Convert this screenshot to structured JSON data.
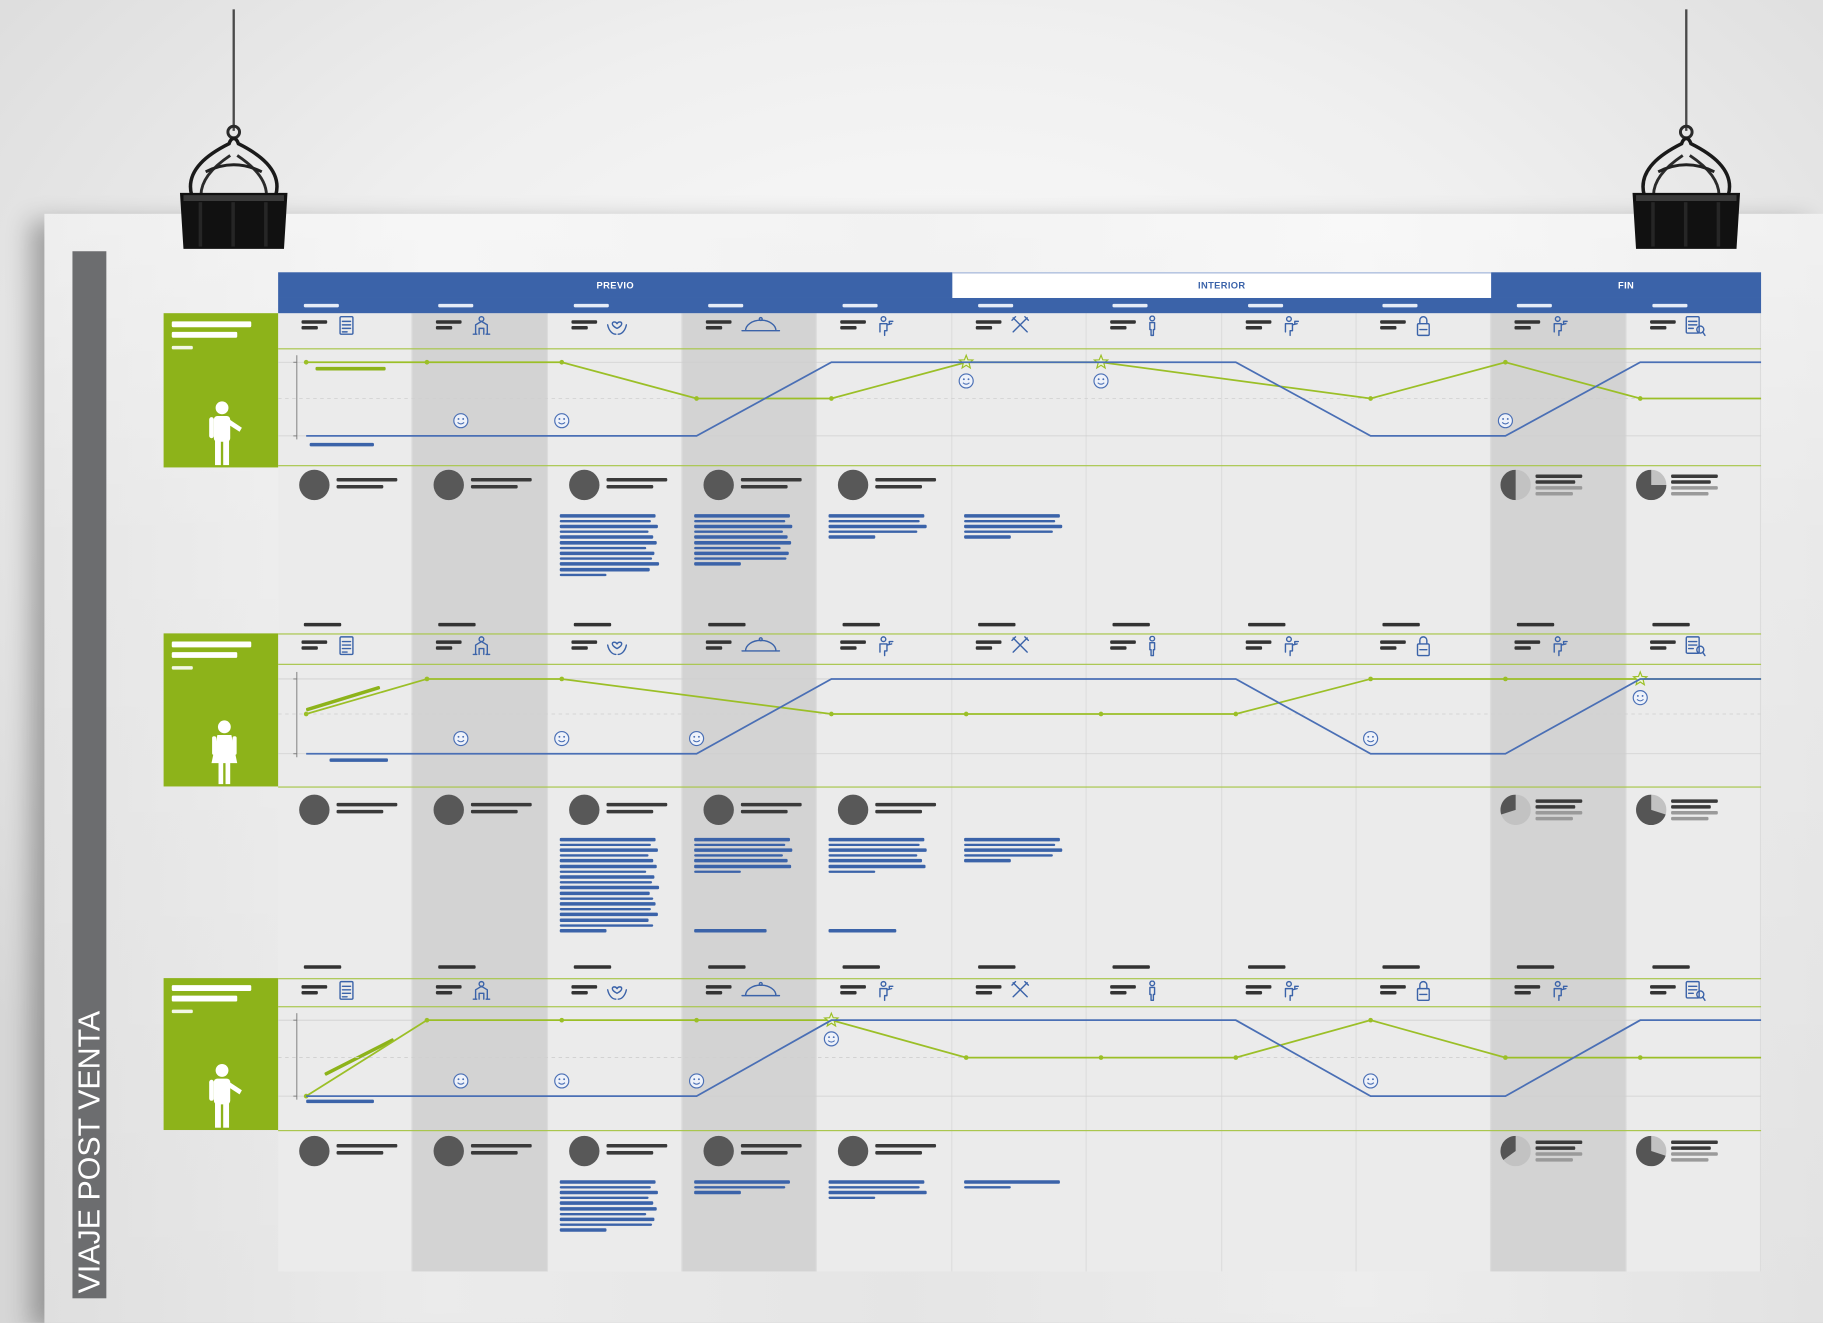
{
  "title": "VIAJE POST VENTA",
  "phases": [
    {
      "label": "PREVIO"
    },
    {
      "label": "INTERIOR"
    },
    {
      "label": "FIN"
    }
  ],
  "stages": [
    {
      "icon": "document-icon"
    },
    {
      "icon": "host-icon"
    },
    {
      "icon": "hands-heart-icon"
    },
    {
      "icon": "cloche-icon"
    },
    {
      "icon": "waiter-icon"
    },
    {
      "icon": "utensils-icon"
    },
    {
      "icon": "person-icon"
    },
    {
      "icon": "waiter-icon"
    },
    {
      "icon": "bag-icon"
    },
    {
      "icon": "waiter-icon"
    },
    {
      "icon": "survey-icon"
    }
  ],
  "personas": [
    {
      "figure": "man-figure-icon",
      "series": [
        {
          "color": "#9bbf27",
          "levels": [
            "high",
            "high",
            "high",
            "mid",
            "mid",
            "high",
            "high",
            null,
            "mid",
            "high",
            "mid"
          ]
        },
        {
          "color": "#4a6fb5",
          "levels": [
            "low",
            "low",
            "low",
            "low",
            "high",
            "high",
            "high",
            "high",
            "low",
            "low",
            "high"
          ]
        }
      ],
      "star_stages": [
        5,
        6
      ],
      "smileys": [
        {
          "stage": 1,
          "level": "low"
        },
        {
          "stage": 2,
          "level": "low"
        },
        {
          "stage": 5,
          "level": "high"
        },
        {
          "stage": 6,
          "level": "high"
        },
        {
          "stage": 9,
          "level": "low"
        }
      ],
      "pie_fractions": [
        0.5,
        0.75
      ]
    },
    {
      "figure": "woman-figure-icon",
      "series": [
        {
          "color": "#9bbf27",
          "levels": [
            "mid",
            "high",
            "high",
            null,
            "mid",
            "mid",
            "mid",
            "mid",
            "high",
            "high",
            "high"
          ]
        },
        {
          "color": "#4a6fb5",
          "levels": [
            "low",
            "low",
            "low",
            "low",
            "high",
            "high",
            "high",
            "high",
            "low",
            "low",
            "high"
          ]
        }
      ],
      "star_stages": [
        10
      ],
      "smileys": [
        {
          "stage": 1,
          "level": "low"
        },
        {
          "stage": 2,
          "level": "low"
        },
        {
          "stage": 3,
          "level": "low"
        },
        {
          "stage": 8,
          "level": "low"
        },
        {
          "stage": 10,
          "level": "high"
        }
      ],
      "pie_fractions": [
        0.3,
        0.7
      ]
    },
    {
      "figure": "man-figure-icon",
      "series": [
        {
          "color": "#9bbf27",
          "levels": [
            "low",
            "high",
            "high",
            "high",
            "high",
            "mid",
            "mid",
            "mid",
            "high",
            "mid",
            "mid"
          ]
        },
        {
          "color": "#4a6fb5",
          "levels": [
            "low",
            "low",
            "low",
            "low",
            "high",
            "high",
            "high",
            "high",
            "low",
            "low",
            "high"
          ]
        }
      ],
      "star_stages": [
        4
      ],
      "smileys": [
        {
          "stage": 1,
          "level": "low"
        },
        {
          "stage": 2,
          "level": "low"
        },
        {
          "stage": 3,
          "level": "low"
        },
        {
          "stage": 4,
          "level": "high"
        },
        {
          "stage": 8,
          "level": "low"
        }
      ],
      "pie_fractions": [
        0.35,
        0.7
      ]
    }
  ],
  "colors": {
    "phase_blue": "#3b63a9",
    "persona_green": "#8db31a",
    "title_bar": "#6c6d6f",
    "shaded_stage": "#d3d3d3",
    "binder_clip": "#111111"
  }
}
